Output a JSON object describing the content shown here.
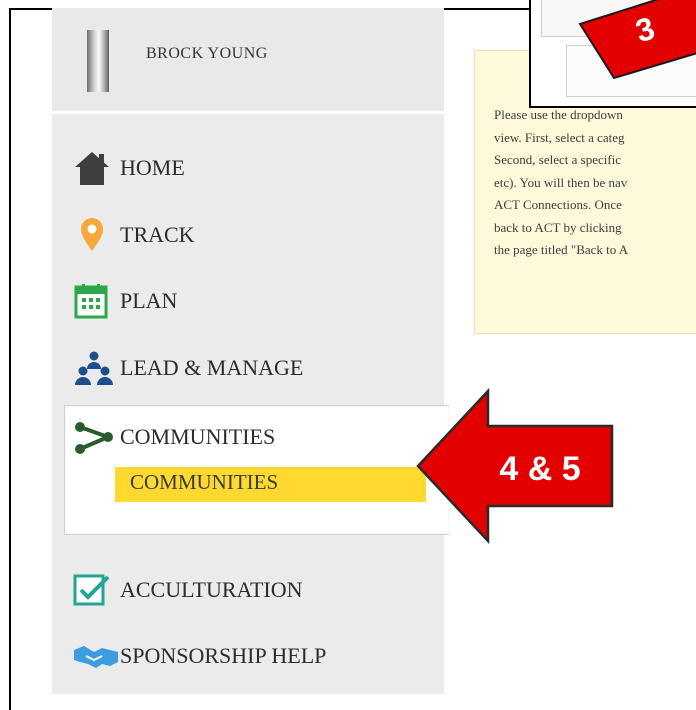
{
  "profile": {
    "name": "BROCK YOUNG"
  },
  "nav": {
    "home": "HOME",
    "track": "TRACK",
    "plan": "PLAN",
    "lead_manage": "LEAD & MANAGE",
    "communities": "COMMUNITIES",
    "communities_sub": "COMMUNITIES",
    "acculturation": "ACCULTURATION",
    "sponsorship": "SPONSORSHIP HELP"
  },
  "instructions": {
    "lines": [
      "Please use the dropdown",
      "view. First, select a categ",
      "Second, select a specific",
      "etc). You will then be nav",
      "ACT Connections. Once",
      "back to ACT by clicking",
      "the page titled \"Back to A"
    ]
  },
  "callouts": {
    "top": "3",
    "side": "4 & 5"
  },
  "colors": {
    "highlight": "#ffd830",
    "callout_red": "#e30000",
    "sidebar_bg": "#ebebeb",
    "info_bg": "#fff9dc"
  }
}
